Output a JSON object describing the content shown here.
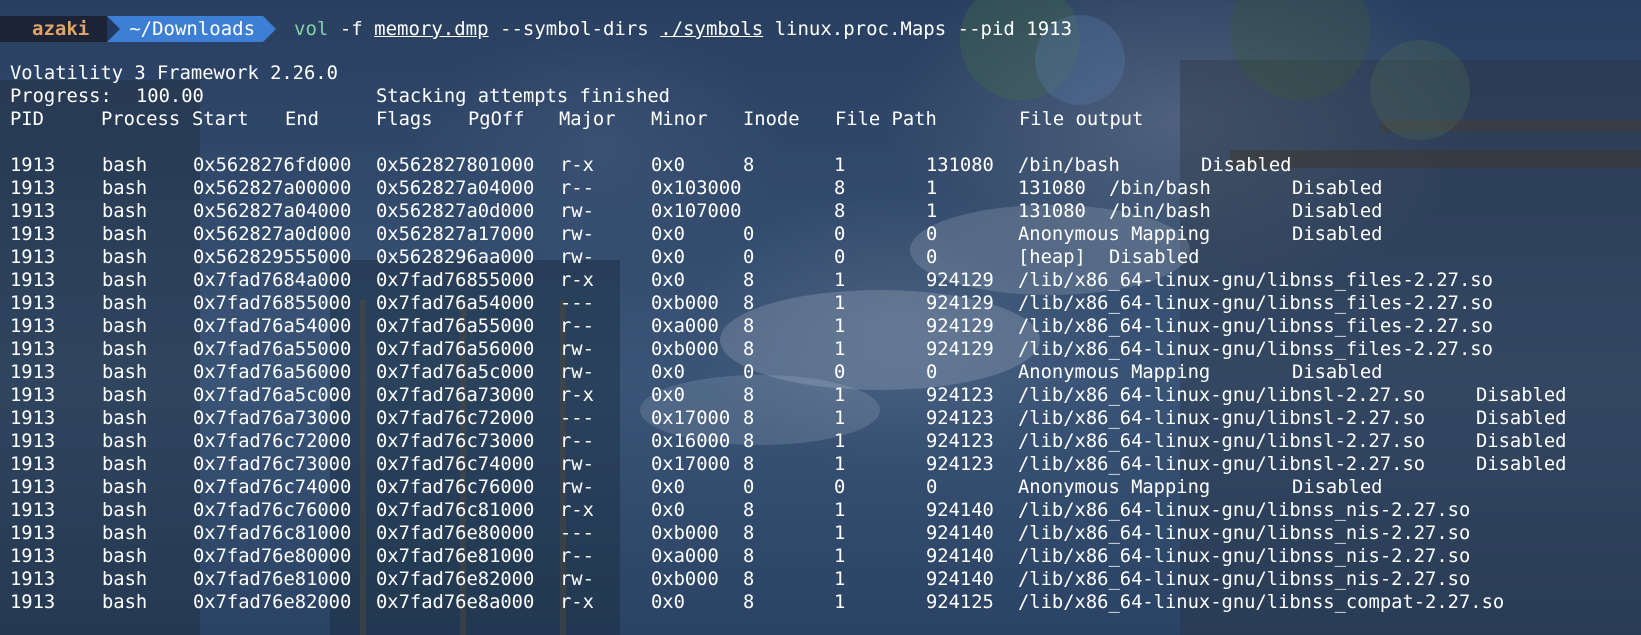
{
  "prompt": {
    "user": "azaki",
    "directory": "~/Downloads",
    "command": {
      "program": "vol",
      "flag1": "-f",
      "dump_file": "memory.dmp",
      "flag2": "--symbol-dirs",
      "symbols_dir": "./symbols",
      "plugin": "linux.proc.Maps",
      "flag3": "--pid",
      "pid": "1913"
    }
  },
  "output": {
    "banner": "Volatility 3 Framework 2.26.0",
    "progress_label": "Progress:",
    "progress_value": "100.00",
    "progress_status": "Stacking attempts finished",
    "headers": [
      "PID",
      "Process",
      "Start",
      "End",
      "Flags",
      "PgOff",
      "Major",
      "Minor",
      "Inode",
      "File Path",
      "File output"
    ],
    "rows": [
      [
        "1913",
        "bash",
        "0x5628276fd000",
        "0x562827801000",
        "r-x",
        "0x0",
        "8",
        "1",
        "131080",
        "/bin/bash",
        "Disabled"
      ],
      [
        "1913",
        "bash",
        "0x562827a00000",
        "0x562827a04000",
        "r--",
        "0x103000",
        "8",
        "1",
        "131080",
        "/bin/bash",
        "Disabled"
      ],
      [
        "1913",
        "bash",
        "0x562827a04000",
        "0x562827a0d000",
        "rw-",
        "0x107000",
        "8",
        "1",
        "131080",
        "/bin/bash",
        "Disabled"
      ],
      [
        "1913",
        "bash",
        "0x562827a0d000",
        "0x562827a17000",
        "rw-",
        "0x0",
        "0",
        "0",
        "0",
        "Anonymous Mapping",
        "Disabled"
      ],
      [
        "1913",
        "bash",
        "0x562829555000",
        "0x5628296aa000",
        "rw-",
        "0x0",
        "0",
        "0",
        "0",
        "[heap]",
        "Disabled"
      ],
      [
        "1913",
        "bash",
        "0x7fad7684a000",
        "0x7fad76855000",
        "r-x",
        "0x0",
        "8",
        "1",
        "924129",
        "/lib/x86_64-linux-gnu/libnss_files-2.27.so",
        ""
      ],
      [
        "1913",
        "bash",
        "0x7fad76855000",
        "0x7fad76a54000",
        "---",
        "0xb000",
        "8",
        "1",
        "924129",
        "/lib/x86_64-linux-gnu/libnss_files-2.27.so",
        ""
      ],
      [
        "1913",
        "bash",
        "0x7fad76a54000",
        "0x7fad76a55000",
        "r--",
        "0xa000",
        "8",
        "1",
        "924129",
        "/lib/x86_64-linux-gnu/libnss_files-2.27.so",
        ""
      ],
      [
        "1913",
        "bash",
        "0x7fad76a55000",
        "0x7fad76a56000",
        "rw-",
        "0xb000",
        "8",
        "1",
        "924129",
        "/lib/x86_64-linux-gnu/libnss_files-2.27.so",
        ""
      ],
      [
        "1913",
        "bash",
        "0x7fad76a56000",
        "0x7fad76a5c000",
        "rw-",
        "0x0",
        "0",
        "0",
        "0",
        "Anonymous Mapping",
        "Disabled"
      ],
      [
        "1913",
        "bash",
        "0x7fad76a5c000",
        "0x7fad76a73000",
        "r-x",
        "0x0",
        "8",
        "1",
        "924123",
        "/lib/x86_64-linux-gnu/libnsl-2.27.so",
        "Disabled"
      ],
      [
        "1913",
        "bash",
        "0x7fad76a73000",
        "0x7fad76c72000",
        "---",
        "0x17000",
        "8",
        "1",
        "924123",
        "/lib/x86_64-linux-gnu/libnsl-2.27.so",
        "Disabled"
      ],
      [
        "1913",
        "bash",
        "0x7fad76c72000",
        "0x7fad76c73000",
        "r--",
        "0x16000",
        "8",
        "1",
        "924123",
        "/lib/x86_64-linux-gnu/libnsl-2.27.so",
        "Disabled"
      ],
      [
        "1913",
        "bash",
        "0x7fad76c73000",
        "0x7fad76c74000",
        "rw-",
        "0x17000",
        "8",
        "1",
        "924123",
        "/lib/x86_64-linux-gnu/libnsl-2.27.so",
        "Disabled"
      ],
      [
        "1913",
        "bash",
        "0x7fad76c74000",
        "0x7fad76c76000",
        "rw-",
        "0x0",
        "0",
        "0",
        "0",
        "Anonymous Mapping",
        "Disabled"
      ],
      [
        "1913",
        "bash",
        "0x7fad76c76000",
        "0x7fad76c81000",
        "r-x",
        "0x0",
        "8",
        "1",
        "924140",
        "/lib/x86_64-linux-gnu/libnss_nis-2.27.so",
        ""
      ],
      [
        "1913",
        "bash",
        "0x7fad76c81000",
        "0x7fad76e80000",
        "---",
        "0xb000",
        "8",
        "1",
        "924140",
        "/lib/x86_64-linux-gnu/libnss_nis-2.27.so",
        ""
      ],
      [
        "1913",
        "bash",
        "0x7fad76e80000",
        "0x7fad76e81000",
        "r--",
        "0xa000",
        "8",
        "1",
        "924140",
        "/lib/x86_64-linux-gnu/libnss_nis-2.27.so",
        ""
      ],
      [
        "1913",
        "bash",
        "0x7fad76e81000",
        "0x7fad76e82000",
        "rw-",
        "0xb000",
        "8",
        "1",
        "924140",
        "/lib/x86_64-linux-gnu/libnss_nis-2.27.so",
        ""
      ],
      [
        "1913",
        "bash",
        "0x7fad76e82000",
        "0x7fad76e8a000",
        "r-x",
        "0x0",
        "8",
        "1",
        "924125",
        "/lib/x86_64-linux-gnu/libnss_compat-2.27.so",
        ""
      ]
    ]
  },
  "colors": {
    "user_segment": "#e0a36b",
    "dir_segment": "#3e7fd6",
    "program": "#7fd3a6",
    "text": "#ffffff"
  }
}
